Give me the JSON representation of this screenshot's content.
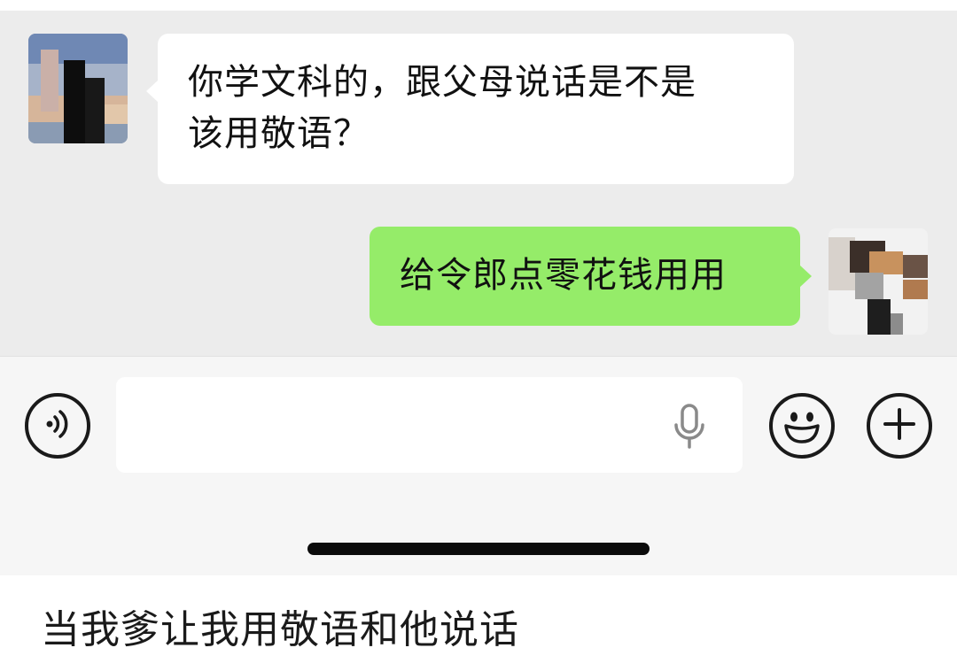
{
  "chat": {
    "messages": [
      {
        "sender": "other",
        "text_line1": "你学文科的，跟父母说话是不是",
        "text_line2": "该用敬语？"
      },
      {
        "sender": "self",
        "text": "给令郎点零花钱用用"
      }
    ]
  },
  "input_bar": {
    "value": "",
    "icons": {
      "voice": "voice-wave-icon",
      "mic": "microphone-icon",
      "emoji": "smiley-face-icon",
      "more": "plus-circle-icon"
    }
  },
  "caption": {
    "text": "当我爹让我用敬语和他说话"
  },
  "colors": {
    "chat_background": "#ececec",
    "incoming_bubble": "#ffffff",
    "outgoing_bubble": "#95ec69",
    "input_bar_background": "#f6f6f6",
    "text": "#111111"
  }
}
